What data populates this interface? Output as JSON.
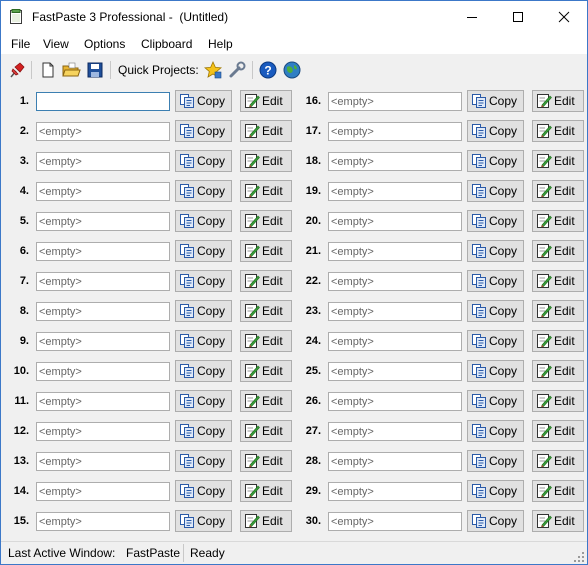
{
  "window": {
    "title": "FastPaste 3 Professional -  (Untitled)",
    "minimize_icon": "minimize-icon",
    "maximize_icon": "maximize-icon",
    "close_icon": "close-icon"
  },
  "menu": [
    "File",
    "View",
    "Options",
    "Clipboard",
    "Help"
  ],
  "toolbar": {
    "quick_projects_label": "Quick Projects:",
    "icons": [
      "pin-icon",
      "new-document-icon",
      "open-folder-icon",
      "save-icon",
      "star-icon",
      "wrench-icon",
      "help-icon",
      "globe-icon"
    ]
  },
  "slots": [
    {
      "num": "1.",
      "value": "",
      "placeholder": ""
    },
    {
      "num": "2.",
      "value": "<empty>"
    },
    {
      "num": "3.",
      "value": "<empty>"
    },
    {
      "num": "4.",
      "value": "<empty>"
    },
    {
      "num": "5.",
      "value": "<empty>"
    },
    {
      "num": "6.",
      "value": "<empty>"
    },
    {
      "num": "7.",
      "value": "<empty>"
    },
    {
      "num": "8.",
      "value": "<empty>"
    },
    {
      "num": "9.",
      "value": "<empty>"
    },
    {
      "num": "10.",
      "value": "<empty>"
    },
    {
      "num": "11.",
      "value": "<empty>"
    },
    {
      "num": "12.",
      "value": "<empty>"
    },
    {
      "num": "13.",
      "value": "<empty>"
    },
    {
      "num": "14.",
      "value": "<empty>"
    },
    {
      "num": "15.",
      "value": "<empty>"
    },
    {
      "num": "16.",
      "value": "<empty>"
    },
    {
      "num": "17.",
      "value": "<empty>"
    },
    {
      "num": "18.",
      "value": "<empty>"
    },
    {
      "num": "19.",
      "value": "<empty>"
    },
    {
      "num": "20.",
      "value": "<empty>"
    },
    {
      "num": "21.",
      "value": "<empty>"
    },
    {
      "num": "22.",
      "value": "<empty>"
    },
    {
      "num": "23.",
      "value": "<empty>"
    },
    {
      "num": "24.",
      "value": "<empty>"
    },
    {
      "num": "25.",
      "value": "<empty>"
    },
    {
      "num": "26.",
      "value": "<empty>"
    },
    {
      "num": "27.",
      "value": "<empty>"
    },
    {
      "num": "28.",
      "value": "<empty>"
    },
    {
      "num": "29.",
      "value": "<empty>"
    },
    {
      "num": "30.",
      "value": "<empty>"
    }
  ],
  "buttons": {
    "copy_label": "Copy",
    "edit_label": "Edit",
    "copy_icon": "copy-icon",
    "edit_icon": "edit-icon"
  },
  "status": {
    "last_active_label": "Last Active Window:",
    "last_active_value": "FastPaste",
    "state": "Ready"
  },
  "colors": {
    "window_border": "#3c78c8",
    "button_face": "#e1e1e1",
    "button_border": "#adadad",
    "background": "#f0f0f0"
  }
}
